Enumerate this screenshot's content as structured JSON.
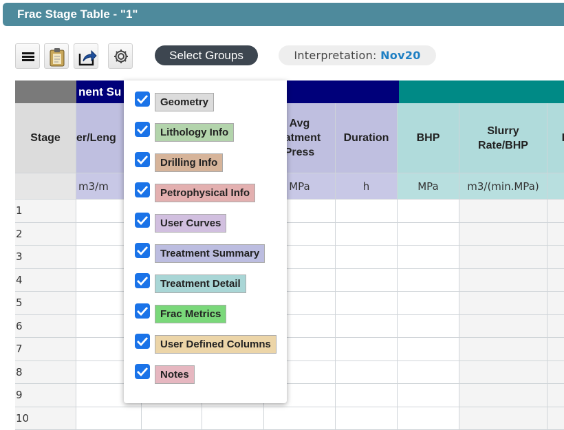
{
  "window": {
    "title": "Frac Stage Table - \"1\""
  },
  "toolbar": {
    "buttons": [
      {
        "icon": "menu-icon"
      },
      {
        "icon": "clipboard-icon"
      },
      {
        "icon": "share-icon"
      },
      {
        "icon": "gear-icon"
      }
    ],
    "select_groups_label": "Select Groups",
    "interpretation_label": "Interpretation:",
    "interpretation_value": "Nov20"
  },
  "table": {
    "groups": [
      {
        "label": "",
        "color": "#7a7a7a"
      },
      {
        "label": "nent Su",
        "color": "#00007a"
      },
      {
        "label": "",
        "color": "#008a86"
      }
    ],
    "columns": [
      {
        "header": "Stage",
        "unit": ""
      },
      {
        "header": "er/Leng",
        "unit": "m3/m"
      },
      {
        "header": "",
        "unit": ""
      },
      {
        "header": "",
        "unit": ""
      },
      {
        "header": "Avg\neatment\nPress",
        "unit": "MPa"
      },
      {
        "header": "Duration",
        "unit": "h"
      },
      {
        "header": "BHP",
        "unit": "MPa"
      },
      {
        "header": "Slurry\nRate/BHP",
        "unit": "m3/(min.MPa)"
      },
      {
        "header": "Br",
        "unit": ""
      }
    ],
    "rows": [
      "1",
      "2",
      "3",
      "4",
      "5",
      "6",
      "7",
      "8",
      "9",
      "10"
    ]
  },
  "dropdown": {
    "options": [
      {
        "label": "Geometry",
        "checked": true,
        "color": "#dcdcdc"
      },
      {
        "label": "Lithology Info",
        "checked": true,
        "color": "#b3d4ac"
      },
      {
        "label": "Drilling Info",
        "checked": true,
        "color": "#d6b49a"
      },
      {
        "label": "Petrophysical Info",
        "checked": true,
        "color": "#e3b0b0"
      },
      {
        "label": "User Curves",
        "checked": true,
        "color": "#d1bfdf"
      },
      {
        "label": "Treatment Summary",
        "checked": true,
        "color": "#bcbde0"
      },
      {
        "label": "Treatment Detail",
        "checked": true,
        "color": "#a9d6d6"
      },
      {
        "label": "Frac Metrics",
        "checked": true,
        "color": "#7ad87a"
      },
      {
        "label": "User Defined Columns",
        "checked": true,
        "color": "#ecd5a8"
      },
      {
        "label": "Notes",
        "checked": true,
        "color": "#e6b7c0"
      }
    ]
  }
}
